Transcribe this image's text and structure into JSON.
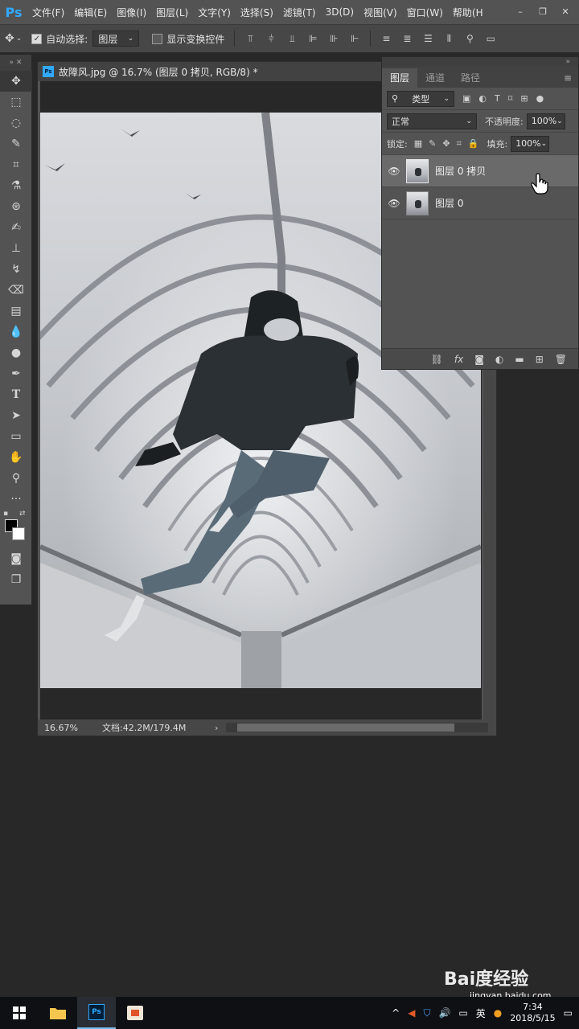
{
  "app": {
    "logo": "Ps",
    "menu": [
      "文件(F)",
      "编辑(E)",
      "图像(I)",
      "图层(L)",
      "文字(Y)",
      "选择(S)",
      "滤镜(T)",
      "3D(D)",
      "视图(V)",
      "窗口(W)",
      "帮助(H"
    ],
    "win_controls": [
      "–",
      "❐",
      "✕"
    ]
  },
  "options": {
    "auto_select_label": "自动选择:",
    "auto_select_value": "图层",
    "show_transform_label": "显示变换控件"
  },
  "document": {
    "title": "故障风.jpg @ 16.7% (图层 0 拷贝, RGB/8) *",
    "zoom": "16.67%",
    "doc_size": "文档:42.2M/179.4M"
  },
  "layers_panel": {
    "tabs": [
      "图层",
      "通道",
      "路径"
    ],
    "filter_kind": "类型",
    "blend_mode": "正常",
    "opacity_label": "不透明度:",
    "opacity_value": "100%",
    "lock_label": "锁定:",
    "fill_label": "填充:",
    "fill_value": "100%",
    "layers": [
      {
        "name": "图层 0 拷贝",
        "selected": true
      },
      {
        "name": "图层 0",
        "selected": false
      }
    ]
  },
  "taskbar": {
    "language": "英",
    "time": "7:34",
    "date": "2018/5/15"
  },
  "watermark": {
    "brand": "Bai度经验",
    "url": "jingyan.baidu.com"
  },
  "colors": {
    "ps_blue": "#31a8ff",
    "panel_bg": "#535353",
    "workspace_bg": "#282828"
  }
}
